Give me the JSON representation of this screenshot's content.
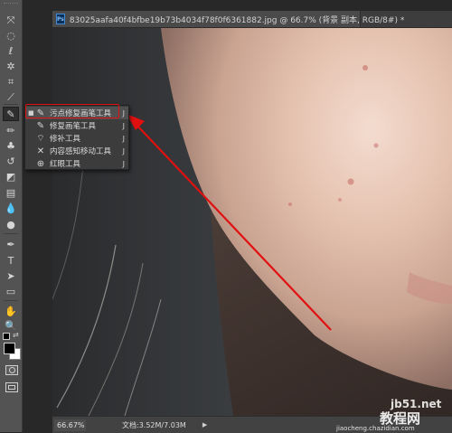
{
  "document": {
    "tab_title": "83025aafa40f4bfbe19b73b4034f78f0f6361882.jpg @ 66.7% (背景 副本, RGB/8#) *",
    "ps_logo": "Ps"
  },
  "toolbar": {
    "tools": [
      {
        "name": "move-tool-icon",
        "glyph": "⤧"
      },
      {
        "name": "marquee-tool-icon",
        "glyph": "◌"
      },
      {
        "name": "lasso-tool-icon",
        "glyph": "ℓ"
      },
      {
        "name": "quick-select-tool-icon",
        "glyph": "✲"
      },
      {
        "name": "crop-tool-icon",
        "glyph": "⌗"
      },
      {
        "name": "eyedropper-tool-icon",
        "glyph": "⟋"
      },
      {
        "name": "spot-healing-brush-tool-icon",
        "glyph": "✎"
      },
      {
        "name": "brush-tool-icon",
        "glyph": "✏"
      },
      {
        "name": "clone-stamp-tool-icon",
        "glyph": "♣"
      },
      {
        "name": "history-brush-tool-icon",
        "glyph": "↺"
      },
      {
        "name": "eraser-tool-icon",
        "glyph": "◩"
      },
      {
        "name": "gradient-tool-icon",
        "glyph": "▤"
      },
      {
        "name": "blur-tool-icon",
        "glyph": "💧"
      },
      {
        "name": "dodge-tool-icon",
        "glyph": "●"
      },
      {
        "name": "pen-tool-icon",
        "glyph": "✒"
      },
      {
        "name": "type-tool-icon",
        "glyph": "T"
      },
      {
        "name": "path-select-tool-icon",
        "glyph": "➤"
      },
      {
        "name": "shape-tool-icon",
        "glyph": "▭"
      },
      {
        "name": "hand-tool-icon",
        "glyph": "✋"
      },
      {
        "name": "zoom-tool-icon",
        "glyph": "🔍"
      }
    ]
  },
  "flyout": {
    "items": [
      {
        "label": "污点修复画笔工具",
        "key": "J",
        "icon": "spot-healing-brush-icon",
        "glyph": "✎",
        "selected": true
      },
      {
        "label": "修复画笔工具",
        "key": "J",
        "icon": "healing-brush-icon",
        "glyph": "✎",
        "selected": false
      },
      {
        "label": "修补工具",
        "key": "J",
        "icon": "patch-tool-icon",
        "glyph": "⌔",
        "selected": false
      },
      {
        "label": "内容感知移动工具",
        "key": "J",
        "icon": "content-aware-move-icon",
        "glyph": "✕",
        "selected": false
      },
      {
        "label": "红眼工具",
        "key": "J",
        "icon": "red-eye-tool-icon",
        "glyph": "⊕",
        "selected": false
      }
    ]
  },
  "status": {
    "zoom": "66.67%",
    "doc_info": "文档:3.52M/7.03M",
    "arrow": "▶"
  },
  "watermark": {
    "site": "jb51.net",
    "label": "教程网",
    "sub": "jiaocheng.chazidian.com"
  },
  "colors": {
    "accent": "#e01010",
    "panel": "#535353"
  }
}
